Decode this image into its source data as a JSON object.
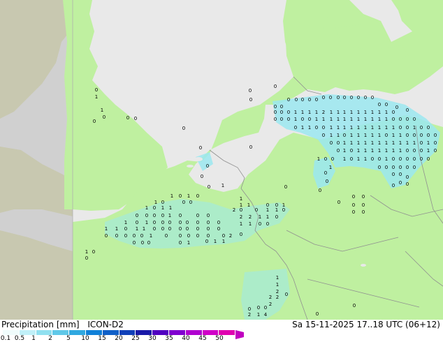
{
  "map": {
    "colors": {
      "sea": "#e9e9e9",
      "land": "#bff0a0",
      "outside": "#d0d0d0",
      "outside_land": "#c8c8b0",
      "rain": "#9be8f0",
      "border": "#909090"
    }
  },
  "cells": [
    [
      138,
      131,
      "0"
    ],
    [
      138,
      141,
      "1"
    ],
    [
      146,
      160,
      "1"
    ],
    [
      149,
      170,
      "0"
    ],
    [
      135,
      176,
      "0"
    ],
    [
      183,
      171,
      "0"
    ],
    [
      194,
      172,
      "0"
    ],
    [
      263,
      186,
      "0"
    ],
    [
      287,
      214,
      "0"
    ],
    [
      358,
      132,
      "0"
    ],
    [
      359,
      145,
      "0"
    ],
    [
      394,
      126,
      "0"
    ],
    [
      359,
      213,
      "0"
    ],
    [
      394,
      155,
      "0"
    ],
    [
      403,
      155,
      "0"
    ],
    [
      413,
      145,
      "0"
    ],
    [
      424,
      145,
      "0"
    ],
    [
      433,
      145,
      "0"
    ],
    [
      443,
      145,
      "0"
    ],
    [
      453,
      145,
      "0"
    ],
    [
      463,
      142,
      "0"
    ],
    [
      473,
      142,
      "0"
    ],
    [
      484,
      142,
      "0"
    ],
    [
      493,
      142,
      "0"
    ],
    [
      503,
      142,
      "0"
    ],
    [
      513,
      142,
      "0"
    ],
    [
      523,
      142,
      "0"
    ],
    [
      533,
      142,
      "0"
    ],
    [
      543,
      152,
      "0"
    ],
    [
      553,
      152,
      "0"
    ],
    [
      568,
      156,
      "0"
    ],
    [
      583,
      160,
      "0"
    ],
    [
      394,
      163,
      "0"
    ],
    [
      403,
      163,
      "0"
    ],
    [
      413,
      163,
      "0"
    ],
    [
      423,
      163,
      "1"
    ],
    [
      433,
      163,
      "1"
    ],
    [
      443,
      163,
      "1"
    ],
    [
      453,
      163,
      "1"
    ],
    [
      463,
      163,
      "2"
    ],
    [
      474,
      163,
      "1"
    ],
    [
      484,
      163,
      "1"
    ],
    [
      493,
      163,
      "1"
    ],
    [
      503,
      163,
      "1"
    ],
    [
      513,
      163,
      "1"
    ],
    [
      523,
      163,
      "1"
    ],
    [
      533,
      163,
      "1"
    ],
    [
      543,
      163,
      "1"
    ],
    [
      553,
      163,
      "1"
    ],
    [
      563,
      163,
      "0"
    ],
    [
      394,
      173,
      "0"
    ],
    [
      403,
      173,
      "0"
    ],
    [
      413,
      173,
      "0"
    ],
    [
      423,
      173,
      "1"
    ],
    [
      433,
      173,
      "0"
    ],
    [
      443,
      173,
      "0"
    ],
    [
      453,
      173,
      "1"
    ],
    [
      463,
      173,
      "1"
    ],
    [
      474,
      173,
      "1"
    ],
    [
      484,
      173,
      "1"
    ],
    [
      493,
      173,
      "1"
    ],
    [
      503,
      173,
      "1"
    ],
    [
      513,
      173,
      "1"
    ],
    [
      523,
      173,
      "1"
    ],
    [
      533,
      173,
      "1"
    ],
    [
      543,
      173,
      "1"
    ],
    [
      553,
      173,
      "1"
    ],
    [
      563,
      173,
      "0"
    ],
    [
      573,
      173,
      "0"
    ],
    [
      583,
      173,
      "0"
    ],
    [
      593,
      173,
      "0"
    ],
    [
      423,
      185,
      "0"
    ],
    [
      433,
      185,
      "1"
    ],
    [
      443,
      185,
      "1"
    ],
    [
      453,
      185,
      "0"
    ],
    [
      463,
      185,
      "0"
    ],
    [
      474,
      185,
      "1"
    ],
    [
      484,
      185,
      "1"
    ],
    [
      493,
      185,
      "1"
    ],
    [
      503,
      185,
      "1"
    ],
    [
      513,
      185,
      "1"
    ],
    [
      523,
      185,
      "1"
    ],
    [
      533,
      185,
      "1"
    ],
    [
      543,
      185,
      "1"
    ],
    [
      553,
      185,
      "1"
    ],
    [
      563,
      185,
      "1"
    ],
    [
      573,
      185,
      "0"
    ],
    [
      583,
      185,
      "0"
    ],
    [
      593,
      185,
      "1"
    ],
    [
      603,
      185,
      "0"
    ],
    [
      613,
      185,
      "0"
    ],
    [
      463,
      196,
      "0"
    ],
    [
      474,
      196,
      "1"
    ],
    [
      484,
      196,
      "1"
    ],
    [
      493,
      196,
      "0"
    ],
    [
      503,
      196,
      "1"
    ],
    [
      513,
      196,
      "1"
    ],
    [
      523,
      196,
      "1"
    ],
    [
      533,
      196,
      "1"
    ],
    [
      543,
      196,
      "1"
    ],
    [
      553,
      196,
      "0"
    ],
    [
      563,
      196,
      "1"
    ],
    [
      573,
      196,
      "1"
    ],
    [
      583,
      196,
      "0"
    ],
    [
      593,
      196,
      "0"
    ],
    [
      603,
      196,
      "0"
    ],
    [
      613,
      196,
      "0"
    ],
    [
      623,
      196,
      "0"
    ],
    [
      474,
      207,
      "0"
    ],
    [
      484,
      207,
      "0"
    ],
    [
      493,
      207,
      "1"
    ],
    [
      503,
      207,
      "1"
    ],
    [
      513,
      207,
      "1"
    ],
    [
      523,
      207,
      "1"
    ],
    [
      533,
      207,
      "1"
    ],
    [
      543,
      207,
      "1"
    ],
    [
      553,
      207,
      "1"
    ],
    [
      563,
      207,
      "1"
    ],
    [
      573,
      207,
      "1"
    ],
    [
      583,
      207,
      "1"
    ],
    [
      593,
      207,
      "1"
    ],
    [
      603,
      207,
      "0"
    ],
    [
      613,
      207,
      "1"
    ],
    [
      623,
      207,
      "0"
    ],
    [
      484,
      218,
      "0"
    ],
    [
      493,
      218,
      "1"
    ],
    [
      503,
      218,
      "0"
    ],
    [
      513,
      218,
      "1"
    ],
    [
      523,
      218,
      "1"
    ],
    [
      533,
      218,
      "1"
    ],
    [
      543,
      218,
      "1"
    ],
    [
      553,
      218,
      "1"
    ],
    [
      563,
      218,
      "1"
    ],
    [
      573,
      218,
      "1"
    ],
    [
      583,
      218,
      "0"
    ],
    [
      593,
      218,
      "0"
    ],
    [
      603,
      218,
      "0"
    ],
    [
      613,
      218,
      "1"
    ],
    [
      623,
      218,
      "0"
    ],
    [
      456,
      230,
      "1"
    ],
    [
      466,
      230,
      "0"
    ],
    [
      476,
      230,
      "0"
    ],
    [
      493,
      230,
      "1"
    ],
    [
      503,
      230,
      "0"
    ],
    [
      513,
      230,
      "1"
    ],
    [
      523,
      230,
      "1"
    ],
    [
      533,
      230,
      "0"
    ],
    [
      543,
      230,
      "0"
    ],
    [
      553,
      230,
      "1"
    ],
    [
      563,
      230,
      "0"
    ],
    [
      573,
      230,
      "0"
    ],
    [
      583,
      230,
      "0"
    ],
    [
      593,
      230,
      "0"
    ],
    [
      603,
      230,
      "0"
    ],
    [
      613,
      230,
      "0"
    ],
    [
      473,
      242,
      "1"
    ],
    [
      543,
      242,
      "0"
    ],
    [
      553,
      242,
      "0"
    ],
    [
      563,
      242,
      "0"
    ],
    [
      573,
      242,
      "0"
    ],
    [
      583,
      242,
      "0"
    ],
    [
      593,
      242,
      "0"
    ],
    [
      466,
      250,
      "0"
    ],
    [
      563,
      252,
      "0"
    ],
    [
      573,
      252,
      "0"
    ],
    [
      583,
      256,
      "0"
    ],
    [
      458,
      275,
      "0"
    ],
    [
      468,
      262,
      "0"
    ],
    [
      409,
      270,
      "0"
    ],
    [
      573,
      264,
      "0"
    ],
    [
      583,
      266,
      "0"
    ],
    [
      563,
      268,
      "0"
    ],
    [
      506,
      284,
      "0"
    ],
    [
      520,
      284,
      "0"
    ],
    [
      485,
      292,
      "0"
    ],
    [
      506,
      296,
      "0"
    ],
    [
      520,
      296,
      "0"
    ],
    [
      506,
      306,
      "0"
    ],
    [
      520,
      306,
      "0"
    ],
    [
      246,
      283,
      "1"
    ],
    [
      258,
      283,
      "0"
    ],
    [
      270,
      283,
      "1"
    ],
    [
      283,
      283,
      "0"
    ],
    [
      299,
      270,
      "0"
    ],
    [
      289,
      255,
      "0"
    ],
    [
      297,
      240,
      "0"
    ],
    [
      319,
      268,
      "1"
    ],
    [
      345,
      287,
      "1"
    ],
    [
      223,
      292,
      "1"
    ],
    [
      233,
      292,
      "0"
    ],
    [
      263,
      292,
      "0"
    ],
    [
      273,
      292,
      "0"
    ],
    [
      210,
      300,
      "1"
    ],
    [
      221,
      300,
      "0"
    ],
    [
      233,
      300,
      "1"
    ],
    [
      244,
      300,
      "1"
    ],
    [
      345,
      296,
      "1"
    ],
    [
      356,
      296,
      "1"
    ],
    [
      383,
      296,
      "0"
    ],
    [
      396,
      296,
      "0"
    ],
    [
      406,
      296,
      "1"
    ],
    [
      196,
      311,
      "0"
    ],
    [
      210,
      311,
      "0"
    ],
    [
      221,
      311,
      "0"
    ],
    [
      233,
      311,
      "0"
    ],
    [
      243,
      311,
      "1"
    ],
    [
      258,
      311,
      "0"
    ],
    [
      283,
      311,
      "0"
    ],
    [
      298,
      311,
      "0"
    ],
    [
      335,
      303,
      "2"
    ],
    [
      345,
      303,
      "0"
    ],
    [
      367,
      303,
      "0"
    ],
    [
      383,
      303,
      "1"
    ],
    [
      396,
      303,
      "1"
    ],
    [
      406,
      303,
      "0"
    ],
    [
      180,
      321,
      "1"
    ],
    [
      196,
      321,
      "0"
    ],
    [
      210,
      321,
      "1"
    ],
    [
      221,
      321,
      "0"
    ],
    [
      233,
      321,
      "0"
    ],
    [
      243,
      321,
      "0"
    ],
    [
      258,
      321,
      "0"
    ],
    [
      268,
      321,
      "0"
    ],
    [
      283,
      321,
      "0"
    ],
    [
      298,
      321,
      "0"
    ],
    [
      313,
      321,
      "0"
    ],
    [
      345,
      313,
      "2"
    ],
    [
      358,
      313,
      "2"
    ],
    [
      372,
      313,
      "1"
    ],
    [
      383,
      313,
      "1"
    ],
    [
      396,
      313,
      "0"
    ],
    [
      152,
      330,
      "1"
    ],
    [
      167,
      330,
      "1"
    ],
    [
      180,
      330,
      "0"
    ],
    [
      196,
      330,
      "1"
    ],
    [
      206,
      330,
      "1"
    ],
    [
      221,
      330,
      "0"
    ],
    [
      233,
      330,
      "0"
    ],
    [
      243,
      330,
      "0"
    ],
    [
      258,
      330,
      "0"
    ],
    [
      268,
      330,
      "0"
    ],
    [
      283,
      330,
      "0"
    ],
    [
      298,
      330,
      "0"
    ],
    [
      313,
      330,
      "0"
    ],
    [
      345,
      323,
      "1"
    ],
    [
      358,
      323,
      "1"
    ],
    [
      372,
      323,
      "0"
    ],
    [
      383,
      323,
      "0"
    ],
    [
      152,
      340,
      "0"
    ],
    [
      167,
      340,
      "0"
    ],
    [
      180,
      340,
      "0"
    ],
    [
      192,
      340,
      "0"
    ],
    [
      203,
      340,
      "0"
    ],
    [
      216,
      340,
      "1"
    ],
    [
      238,
      340,
      "0"
    ],
    [
      258,
      340,
      "0"
    ],
    [
      270,
      340,
      "0"
    ],
    [
      283,
      340,
      "0"
    ],
    [
      298,
      340,
      "0"
    ],
    [
      320,
      340,
      "0"
    ],
    [
      330,
      340,
      "2"
    ],
    [
      345,
      338,
      "0"
    ],
    [
      192,
      350,
      "0"
    ],
    [
      204,
      350,
      "0"
    ],
    [
      213,
      350,
      "0"
    ],
    [
      258,
      350,
      "0"
    ],
    [
      270,
      350,
      "1"
    ],
    [
      296,
      348,
      "0"
    ],
    [
      308,
      348,
      "1"
    ],
    [
      320,
      348,
      "1"
    ],
    [
      124,
      363,
      "1"
    ],
    [
      134,
      363,
      "0"
    ],
    [
      124,
      372,
      "0"
    ],
    [
      397,
      400,
      "1"
    ],
    [
      397,
      410,
      "1"
    ],
    [
      397,
      420,
      "2"
    ],
    [
      387,
      428,
      "2"
    ],
    [
      397,
      428,
      "2"
    ],
    [
      410,
      424,
      "0"
    ],
    [
      387,
      438,
      "2"
    ],
    [
      370,
      443,
      "0"
    ],
    [
      380,
      443,
      "0"
    ],
    [
      357,
      445,
      "0"
    ],
    [
      357,
      453,
      "2"
    ],
    [
      370,
      453,
      "1"
    ],
    [
      380,
      453,
      "4"
    ],
    [
      507,
      440,
      "0"
    ],
    [
      454,
      452,
      "0"
    ]
  ],
  "footer": {
    "title_label": "Precipitation [mm]",
    "model": "ICON-D2",
    "timestamp": "Sa 15-11-2025 17..18 UTC (06+12)"
  },
  "legend": {
    "colors": [
      "#f0fcfc",
      "#c0f0f8",
      "#90e0f0",
      "#60c8e8",
      "#30a8e0",
      "#1080d8",
      "#1060c8",
      "#1040b8",
      "#1818a8",
      "#5000c0",
      "#8000d0",
      "#b000d0",
      "#d000c8",
      "#e000b0"
    ],
    "ticks": [
      "0.1",
      "0.5",
      "1",
      "2",
      "5",
      "10",
      "15",
      "20",
      "25",
      "30",
      "35",
      "40",
      "45",
      "50"
    ]
  }
}
